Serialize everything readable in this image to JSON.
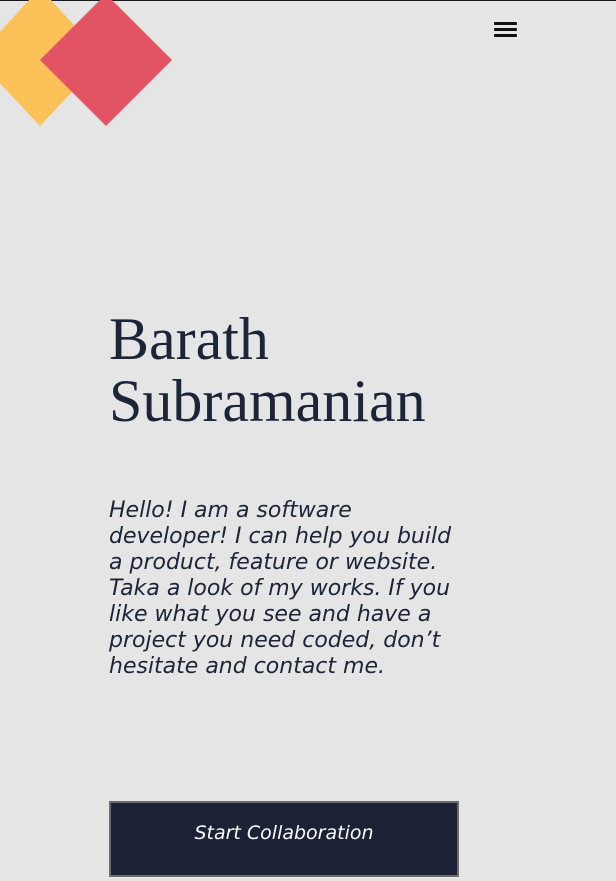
{
  "colors": {
    "background": "#e5e5e5",
    "logo_yellow": "#fdc15a",
    "logo_red": "#e25364",
    "heading": "#1c2438",
    "button_bg": "#1b2236",
    "button_text": "#ffffff"
  },
  "header": {
    "logo": "diamond-logo",
    "menu_icon": "hamburger-menu-icon"
  },
  "hero": {
    "name_line1": "Barath",
    "name_line2": "Subramanian",
    "intro": "Hello! I am a software developer! I can help you build a product, feature or website. Taka a look of my works. If you like what you see and have a project you need coded, don’t hesitate and contact me.",
    "cta_label": "Start Collaboration"
  }
}
